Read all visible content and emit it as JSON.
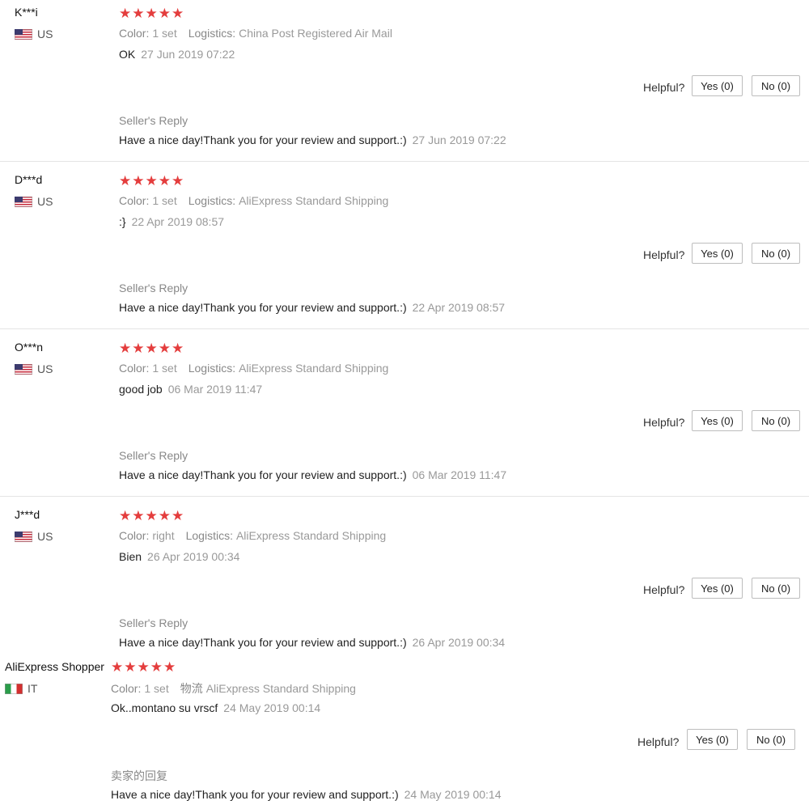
{
  "reviews": [
    {
      "user": "K***i",
      "country": "US",
      "flag": "us-flag-icon",
      "stars": "★★★★★",
      "color_label": "Color:",
      "color_value": "1 set",
      "logistics_label": "Logistics:",
      "logistics_value": "China Post Registered Air Mail",
      "feedback": "OK",
      "date": "27 Jun 2019 07:22",
      "helpful_label": "Helpful?",
      "yes_label": "Yes (0)",
      "no_label": "No (0)",
      "reply_title": "Seller's Reply",
      "reply_text": "Have a nice day!Thank you for your review and support.:)",
      "reply_date": "27 Jun 2019 07:22"
    },
    {
      "user": "D***d",
      "country": "US",
      "flag": "us-flag-icon",
      "stars": "★★★★★",
      "color_label": "Color:",
      "color_value": "1 set",
      "logistics_label": "Logistics:",
      "logistics_value": "AliExpress Standard Shipping",
      "feedback": ":}",
      "date": "22 Apr 2019 08:57",
      "helpful_label": "Helpful?",
      "yes_label": "Yes (0)",
      "no_label": "No (0)",
      "reply_title": "Seller's Reply",
      "reply_text": "Have a nice day!Thank you for your review and support.:)",
      "reply_date": "22 Apr 2019 08:57"
    },
    {
      "user": "O***n",
      "country": "US",
      "flag": "us-flag-icon",
      "stars": "★★★★★",
      "color_label": "Color:",
      "color_value": "1 set",
      "logistics_label": "Logistics:",
      "logistics_value": "AliExpress Standard Shipping",
      "feedback": "good job",
      "date": "06 Mar 2019 11:47",
      "helpful_label": "Helpful?",
      "yes_label": "Yes (0)",
      "no_label": "No (0)",
      "reply_title": "Seller's Reply",
      "reply_text": "Have a nice day!Thank you for your review and support.:)",
      "reply_date": "06 Mar 2019 11:47"
    },
    {
      "user": "J***d",
      "country": "US",
      "flag": "us-flag-icon",
      "stars": "★★★★★",
      "color_label": "Color:",
      "color_value": "right",
      "logistics_label": "Logistics:",
      "logistics_value": "AliExpress Standard Shipping",
      "feedback": "Bien",
      "date": "26 Apr 2019 00:34",
      "helpful_label": "Helpful?",
      "yes_label": "Yes (0)",
      "no_label": "No (0)",
      "reply_title": "Seller's Reply",
      "reply_text": "Have a nice day!Thank you for your review and support.:)",
      "reply_date": "26 Apr 2019 00:34"
    },
    {
      "user": "AliExpress Shopper",
      "country": "IT",
      "flag": "italy-flag-icon",
      "stars": "★★★★★",
      "color_label": "Color:",
      "color_value": "1 set",
      "logistics_label": "物流",
      "logistics_value": "AliExpress Standard Shipping",
      "feedback": "Ok..montano su vrscf",
      "date": "24 May 2019 00:14",
      "helpful_label": "Helpful?",
      "yes_label": "Yes (0)",
      "no_label": "No (0)",
      "reply_title": "卖家的回复",
      "reply_text": "Have a nice day!Thank you for your review and support.:)",
      "reply_date": "24 May 2019 00:14"
    }
  ],
  "colors": {
    "star": "#e43d3d",
    "muted": "#999999",
    "border": "#bdbdbd"
  }
}
